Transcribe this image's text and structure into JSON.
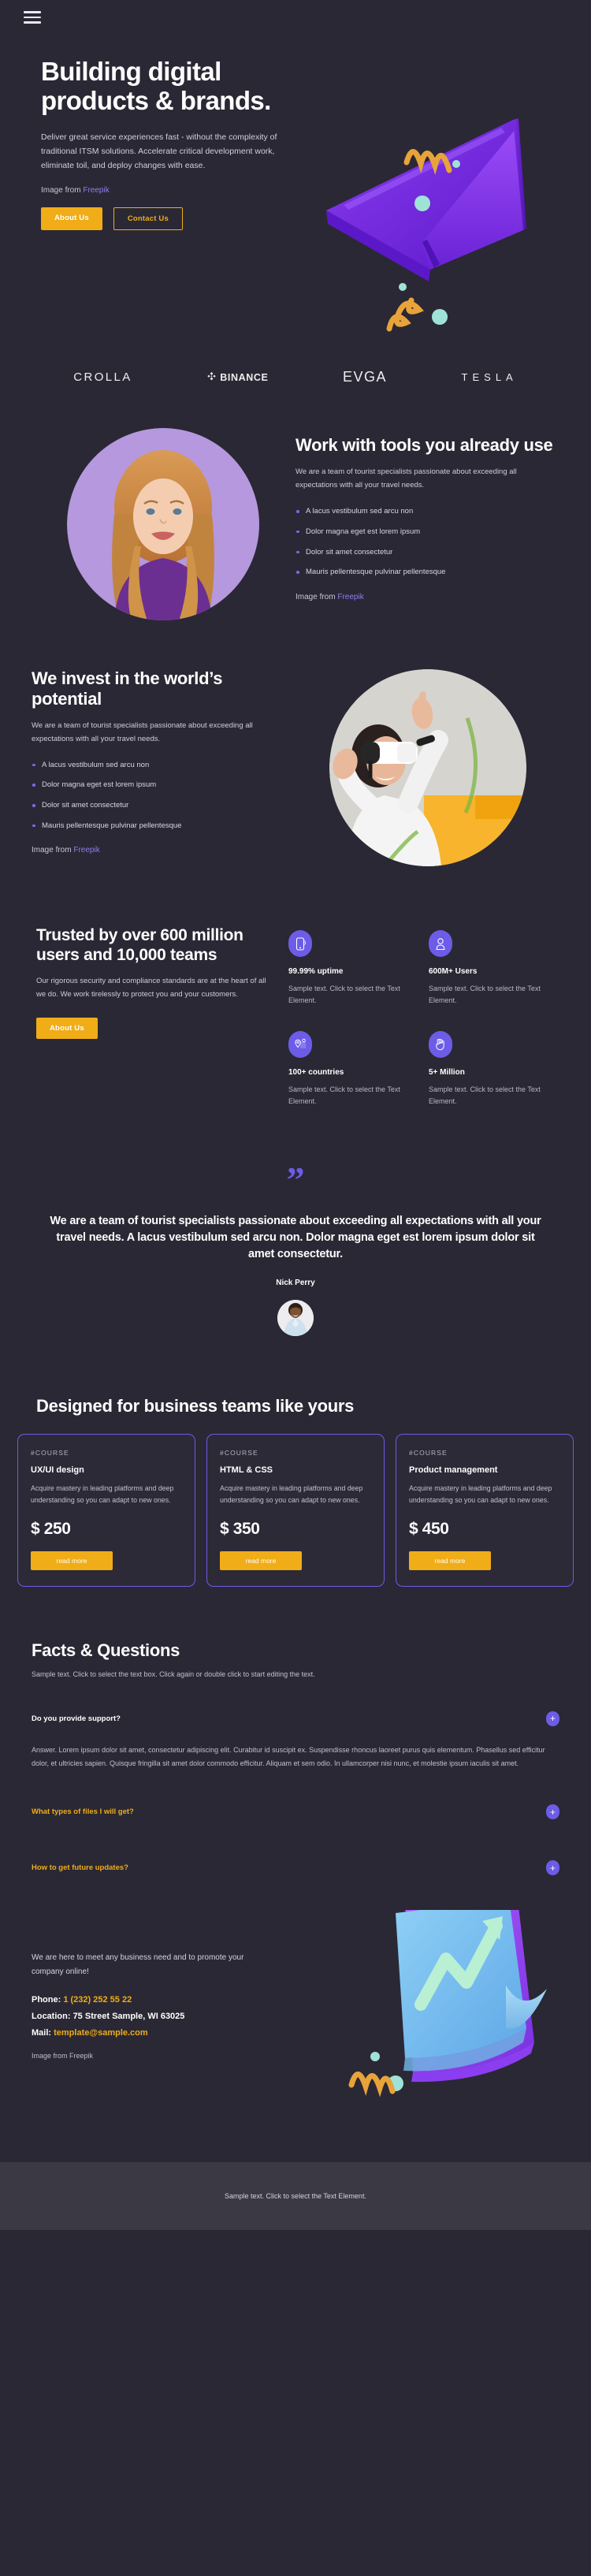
{
  "nav": {
    "menu_icon": "hamburger-menu-icon"
  },
  "hero": {
    "title": "Building digital products & brands.",
    "subtitle": "Deliver great service experiences fast - without the complexity of traditional ITSM solutions. Accelerate critical development work, eliminate toil, and deploy changes with ease.",
    "credit_prefix": "Image from ",
    "credit_link": "Freepik",
    "primary_button": "About Us",
    "secondary_button": "Contact Us",
    "art": "paper-plane-3d-illustration"
  },
  "logos": [
    {
      "name": "CROLLA",
      "key": "crolla"
    },
    {
      "name": "BINANCE",
      "key": "binance"
    },
    {
      "name": "EVGA",
      "key": "evga"
    },
    {
      "name": "TESLA",
      "key": "tesla"
    }
  ],
  "tools_section": {
    "title": "Work with tools you already use",
    "paragraph": "We are a team of tourist specialists passionate about exceeding all expectations with all your travel needs.",
    "bullets": [
      "A lacus vestibulum sed arcu non",
      "Dolor magna eget est lorem ipsum",
      "Dolor sit amet consectetur",
      "Mauris pellentesque pulvinar pellentesque"
    ],
    "credit_prefix": "Image from ",
    "credit_link": "Freepik",
    "image": "portrait-woman-purple-background"
  },
  "invest_section": {
    "title": "We invest in the world’s potential",
    "paragraph": "We are a team of tourist specialists passionate about exceeding all expectations with all your travel needs.",
    "bullets": [
      "A lacus vestibulum sed arcu non",
      "Dolor magna eget est lorem ipsum",
      "Dolor sit amet consectetur",
      "Mauris pellentesque pulvinar pellentesque"
    ],
    "credit_prefix": "Image from ",
    "credit_link": "Freepik",
    "image": "woman-vr-headset-photo"
  },
  "trusted_section": {
    "title": "Trusted by over 600 million users and 10,000 teams",
    "paragraph": "Our rigorous security and compliance standards are at the heart of all we do. We work tirelessly to protect you and your customers.",
    "button": "About Us",
    "stats": [
      {
        "icon": "mobile-phone-icon",
        "title": "99.99% uptime",
        "desc": "Sample text. Click to select the Text Element."
      },
      {
        "icon": "user-person-icon",
        "title": "600M+ Users",
        "desc": "Sample text. Click to select the Text Element."
      },
      {
        "icon": "map-pin-location-icon",
        "title": "100+ countries",
        "desc": "Sample text. Click to select the Text Element."
      },
      {
        "icon": "hand-raised-icon",
        "title": "5+ Million",
        "desc": "Sample text. Click to select the Text Element."
      }
    ]
  },
  "testimonial": {
    "quote_icon": "quotation-mark-icon",
    "text": "We are a team of tourist specialists passionate about exceeding all expectations with all your travel needs. A lacus vestibulum sed arcu non. Dolor magna eget est lorem ipsum dolor sit amet consectetur.",
    "author": "Nick Perry",
    "avatar": "avatar-portrait-man"
  },
  "pricing": {
    "title": "Designed for business teams like yours",
    "cards": [
      {
        "tag": "#COURSE",
        "title": "UX/UI design",
        "desc": "Acquire mastery in leading platforms and deep understanding so you can adapt to new ones.",
        "price": "$ 250",
        "button": "read more"
      },
      {
        "tag": "#COURSE",
        "title": "HTML & CSS",
        "desc": "Acquire mastery in leading platforms and deep understanding so you can adapt to new ones.",
        "price": "$ 350",
        "button": "read more"
      },
      {
        "tag": "#COURSE",
        "title": "Product management",
        "desc": "Acquire mastery in leading platforms and deep understanding so you can adapt to new ones.",
        "price": "$ 450",
        "button": "read more"
      }
    ]
  },
  "faq": {
    "title": "Facts & Questions",
    "lead": "Sample text. Click to select the text box. Click again or double click to start editing the text.",
    "items": [
      {
        "question": "Do you provide support?",
        "answer": "Answer. Lorem ipsum dolor sit amet, consectetur adipiscing elit. Curabitur id suscipit ex. Suspendisse rhoncus laoreet purus quis elementum. Phasellus sed efficitur dolor, et ultricies sapien. Quisque fringilla sit amet dolor commodo efficitur. Aliquam et sem odio. In ullamcorper nisi nunc, et molestie ipsum iaculis sit amet.",
        "open": true,
        "toggle_icon": "plus-icon"
      },
      {
        "question": "What types of files I will get?",
        "answer": "",
        "open": false,
        "toggle_icon": "plus-icon"
      },
      {
        "question": "How to get future updates?",
        "answer": "",
        "open": false,
        "toggle_icon": "plus-icon"
      }
    ]
  },
  "contact": {
    "lead": "We are here to meet any business need and to promote your company online!",
    "phone_label": "Phone: ",
    "phone_value": "1 (232) 252 55 22",
    "location_label": "Location: ",
    "location_value": "75 Street Sample, WI 63025",
    "mail_label": "Mail: ",
    "mail_value": "template@sample.com",
    "credit": "Image from Freepik",
    "art": "growth-chart-card-3d-illustration"
  },
  "footer": {
    "text": "Sample text. Click to select the Text Element."
  },
  "colors": {
    "background": "#2a2834",
    "accent_purple": "#6c5ce7",
    "accent_gold": "#f0ad18",
    "footer_bar": "#3a3944",
    "text_muted": "#c2c0cc"
  }
}
